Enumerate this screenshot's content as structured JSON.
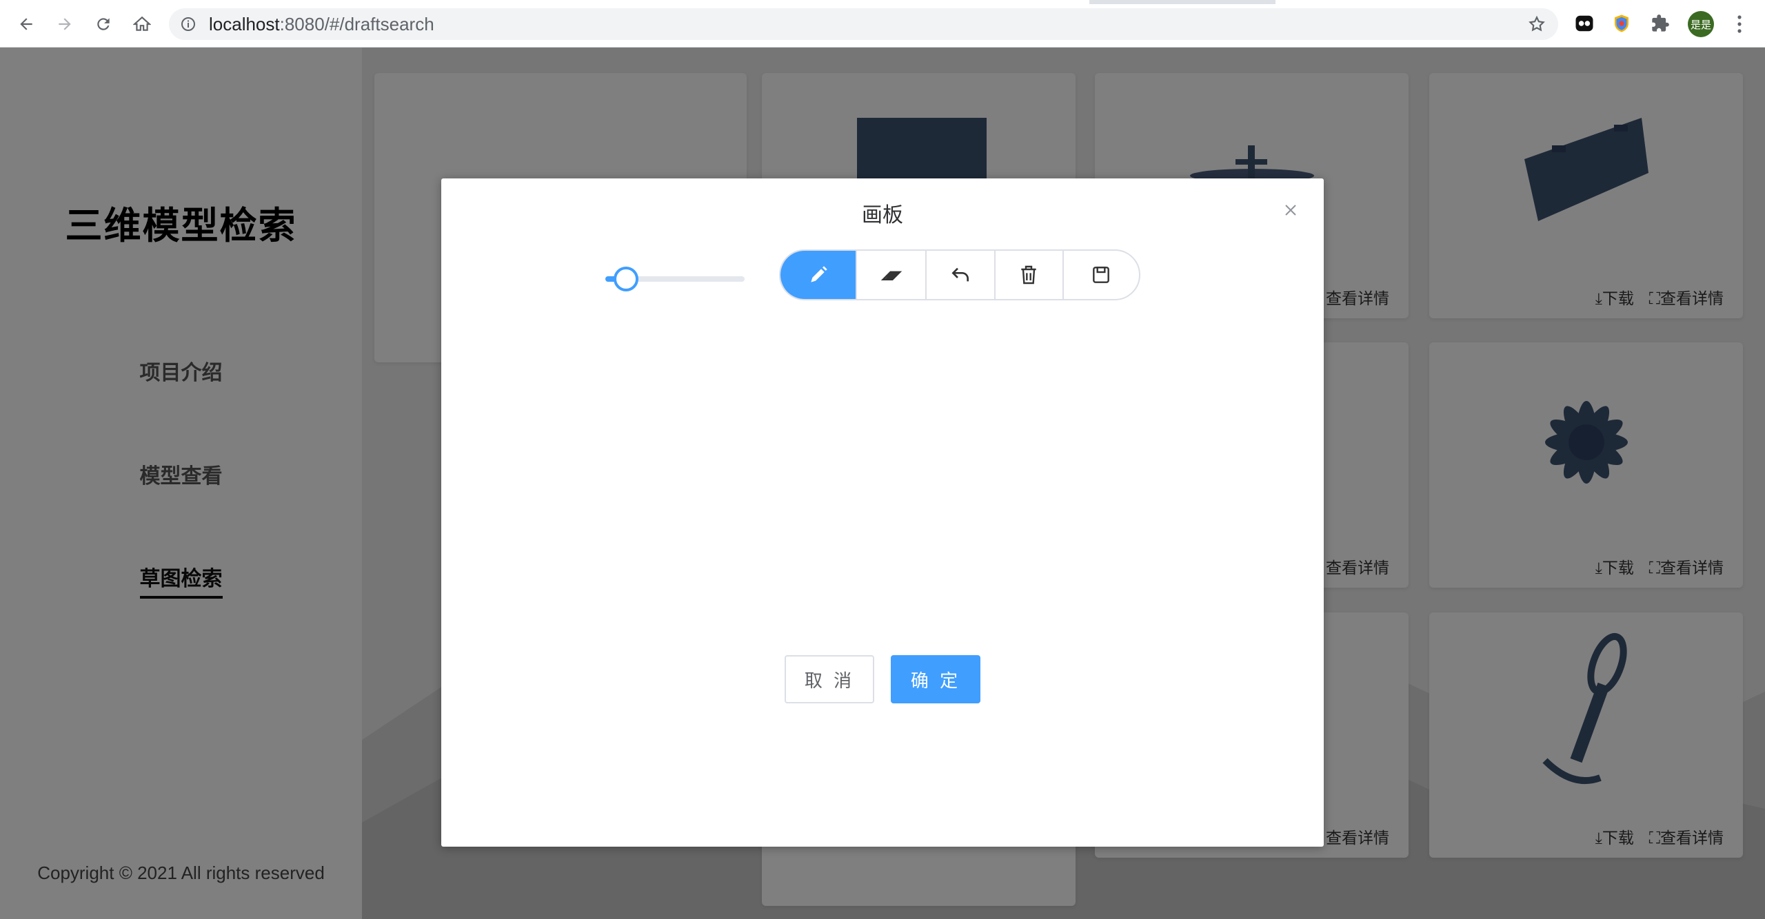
{
  "browser": {
    "url_host": "localhost",
    "url_rest": ":8080/#/draftsearch",
    "profile_label": "是是"
  },
  "sidebar": {
    "title": "三维模型检索",
    "items": [
      {
        "label": "项目介绍",
        "active": false
      },
      {
        "label": "模型查看",
        "active": false
      },
      {
        "label": "草图检索",
        "active": true
      }
    ],
    "copyright": "Copyright © 2021 All rights reserved"
  },
  "cards": {
    "download_label": "⤓下载",
    "details_label": "⛶查看详情",
    "details_label_partial": "查看详情"
  },
  "dialog": {
    "title": "画板",
    "brush_size": 0.15,
    "tools": [
      {
        "name": "pencil",
        "active": true
      },
      {
        "name": "eraser",
        "active": false
      },
      {
        "name": "undo",
        "active": false
      },
      {
        "name": "clear",
        "active": false
      },
      {
        "name": "save",
        "active": false
      }
    ],
    "cancel_label": "取 消",
    "ok_label": "确 定"
  },
  "colors": {
    "accent": "#409eff",
    "overlay": "rgba(0,0,0,0.5)",
    "model": "#3d5270"
  }
}
